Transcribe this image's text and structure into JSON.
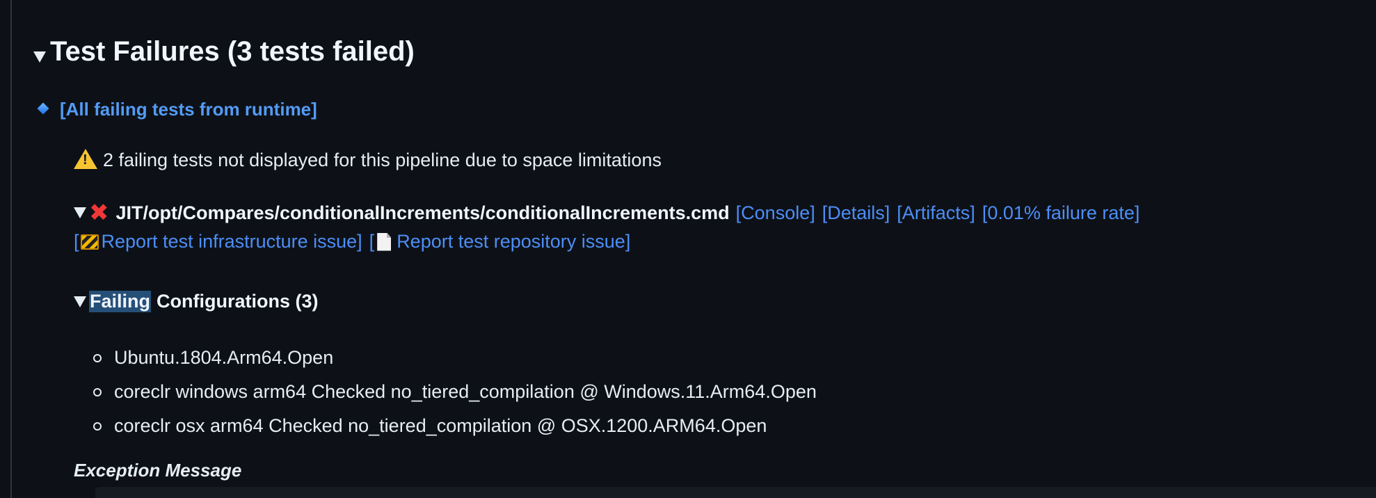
{
  "summary": {
    "title": "Test Failures (3 tests failed)"
  },
  "runtime_link": {
    "label": "[All failing tests from runtime]"
  },
  "warning": {
    "text": "2 failing tests not displayed for this pipeline due to space limitations"
  },
  "test": {
    "name": "JIT/opt/Compares/conditionalIncrements/conditionalIncrements.cmd",
    "links": {
      "console": "[Console]",
      "details": "[Details]",
      "artifacts": "[Artifacts]",
      "failure_rate": "[0.01% failure rate]"
    },
    "report": {
      "open_bracket_1": "[",
      "infra": "Report test infrastructure issue]",
      "open_bracket_2": "[",
      "repo": "Report test repository issue]"
    }
  },
  "configurations": {
    "heading_highlight": "Failing",
    "heading_rest": "Configurations (3)",
    "items": [
      "Ubuntu.1804.Arm64.Open",
      "coreclr windows arm64 Checked no_tiered_compilation @ Windows.11.Arm64.Open",
      "coreclr osx arm64 Checked no_tiered_compilation @ OSX.1200.ARM64.Open"
    ]
  },
  "exception": {
    "label": "Exception Message"
  },
  "icons": {
    "disclosure": "triangle-down-icon",
    "runtime": "blue-diamond-icon",
    "warning": "warning-icon",
    "failed": "red-x-icon",
    "infra": "construction-barrier-icon",
    "repo": "page-icon",
    "bullet": "circle-bullet-icon"
  },
  "colors": {
    "background": "#0d1117",
    "link": "#4d8ef7",
    "error": "#f03838",
    "warning": "#f6c531",
    "selection": "#264f78"
  }
}
